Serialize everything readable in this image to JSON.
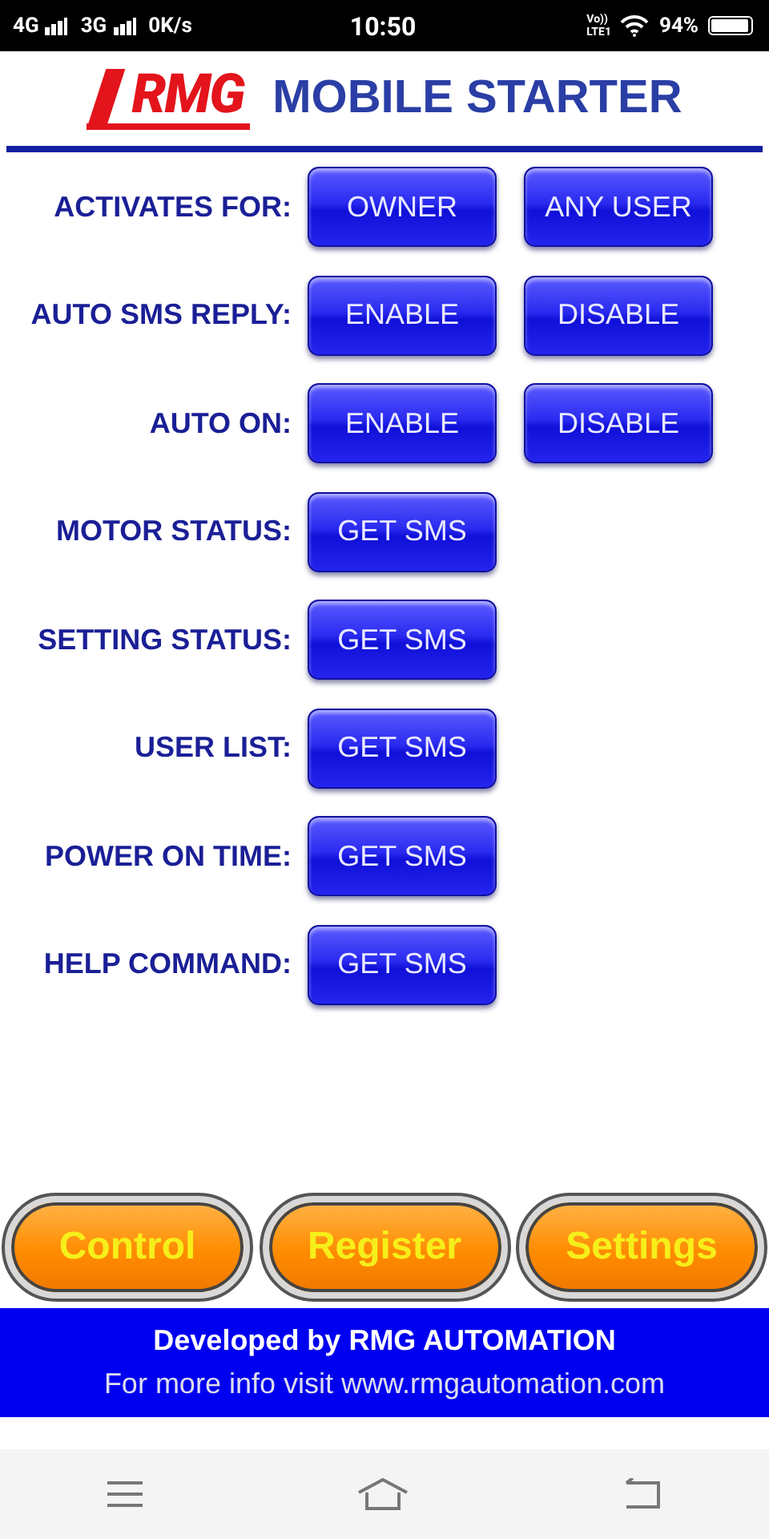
{
  "status_bar": {
    "network_1": "4G",
    "network_2": "3G",
    "speed": "0K/s",
    "time": "10:50",
    "volte_top": "Vo))",
    "volte_bottom": "LTE1",
    "battery": "94%"
  },
  "header": {
    "logo": "RMG",
    "title": "MOBILE STARTER"
  },
  "rows": [
    {
      "label": "ACTIVATES FOR:",
      "buttons": [
        "OWNER",
        "ANY USER"
      ]
    },
    {
      "label": "AUTO SMS REPLY:",
      "buttons": [
        "ENABLE",
        "DISABLE"
      ]
    },
    {
      "label": "AUTO ON:",
      "buttons": [
        "ENABLE",
        "DISABLE"
      ]
    },
    {
      "label": "MOTOR STATUS:",
      "buttons": [
        "GET SMS"
      ]
    },
    {
      "label": "SETTING STATUS:",
      "buttons": [
        "GET SMS"
      ]
    },
    {
      "label": "USER LIST:",
      "buttons": [
        "GET SMS"
      ]
    },
    {
      "label": "POWER ON TIME:",
      "buttons": [
        "GET SMS"
      ]
    },
    {
      "label": "HELP COMMAND:",
      "buttons": [
        "GET SMS"
      ]
    }
  ],
  "bottom_tabs": [
    "Control",
    "Register",
    "Settings"
  ],
  "footer": {
    "credit": "Developed by RMG AUTOMATION",
    "info": "For more info visit www.rmgautomation.com"
  }
}
